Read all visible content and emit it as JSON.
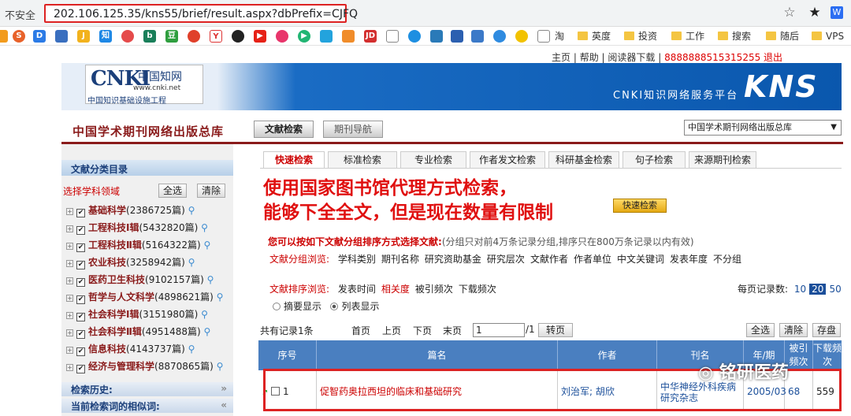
{
  "browser": {
    "security": "不安全",
    "url": "202.106.125.35/kns55/brief/result.aspx?dbPrefix=CJFQ",
    "star_icon": "star-icon",
    "bookmark_label": "淘",
    "bookmarks_text": [
      "淘",
      "英度",
      "投资",
      "工作",
      "搜索",
      "随后",
      "VPS"
    ]
  },
  "toplinks": {
    "home": "主页",
    "help": "帮助",
    "reader": "阅读器下载",
    "account": "8888888515315255",
    "logout": "退出"
  },
  "header": {
    "logo_cnki": "CNKI",
    "logo_cn": "中国知网",
    "logo_url": "www.cnki.net",
    "logo_tag": "中国知识基础设施工程",
    "platform": "CNKI知识网络服务平台",
    "kns": "KNS"
  },
  "title_row": {
    "pub_title": "中国学术期刊网络出版总库",
    "tab_search": "文献检索",
    "tab_nav": "期刊导航",
    "db_select": "中国学术期刊网络出版总库"
  },
  "sidebar": {
    "head": "文献分类目录",
    "select_label": "选择学科领域",
    "select_all": "全选",
    "clear": "清除",
    "categories": [
      {
        "name": "基础科学",
        "count": "(2386725篇)"
      },
      {
        "name": "工程科技Ⅰ辑",
        "count": "(5432820篇)"
      },
      {
        "name": "工程科技Ⅱ辑",
        "count": "(5164322篇)"
      },
      {
        "name": "农业科技",
        "count": "(3258942篇)"
      },
      {
        "name": "医药卫生科技",
        "count": "(9102157篇)"
      },
      {
        "name": "哲学与人文科学",
        "count": "(4898621篇)"
      },
      {
        "name": "社会科学Ⅰ辑",
        "count": "(3151980篇)"
      },
      {
        "name": "社会科学Ⅱ辑",
        "count": "(4951488篇)"
      },
      {
        "name": "信息科技",
        "count": "(4143737篇)"
      },
      {
        "name": "经济与管理科学",
        "count": "(8870865篇)"
      }
    ],
    "history": "检索历史:",
    "related": "当前检索词的相似词:"
  },
  "search_tabs": [
    "快速检索",
    "标准检索",
    "专业检索",
    "作者发文检索",
    "科研基金检索",
    "句子检索",
    "来源期刊检索"
  ],
  "overlay": {
    "line1": "使用国家图书馆代理方式检索，",
    "line2": "能够下全全文，但是现在数量有限制"
  },
  "quick_search_btn": "快速检索",
  "group": {
    "note_bold": "您可以按如下文献分组排序方式选择文献:",
    "note_rest": "(分组只对前4万条记录分组,排序只在800万条记录以内有效)",
    "label": "文献分组浏览:",
    "items": [
      "学科类别",
      "期刊名称",
      "研究资助基金",
      "研究层次",
      "文献作者",
      "作者单位",
      "中文关键词",
      "发表年度",
      "不分组"
    ]
  },
  "sort": {
    "label": "文献排序浏览:",
    "items": [
      "发表时间",
      "相关度",
      "被引频次",
      "下载频次"
    ],
    "active": "相关度",
    "perpage_label": "每页记录数:",
    "perpage": [
      "10",
      "20",
      "50"
    ],
    "perpage_current": "20",
    "disp_abstract": "摘要显示",
    "disp_list": "列表显示"
  },
  "pager": {
    "total": "共有记录1条",
    "first": "首页",
    "prev": "上页",
    "next": "下页",
    "last": "末页",
    "page_value": "1",
    "page_total": "/1",
    "go": "转页",
    "select_all": "全选",
    "clear": "清除",
    "save": "存盘"
  },
  "table": {
    "headers": [
      "序号",
      "篇名",
      "作者",
      "刊名",
      "年/期",
      "被引频次",
      "下载频次"
    ],
    "row": {
      "no": "1",
      "title": "促智药奥拉西坦的临床和基础研究",
      "authors": "刘治军; 胡欣",
      "journal": "中华神经外科疾病研究杂志",
      "year": "2005/03",
      "cited": "68",
      "downloads": "559"
    }
  },
  "watermark": "铭研医药"
}
